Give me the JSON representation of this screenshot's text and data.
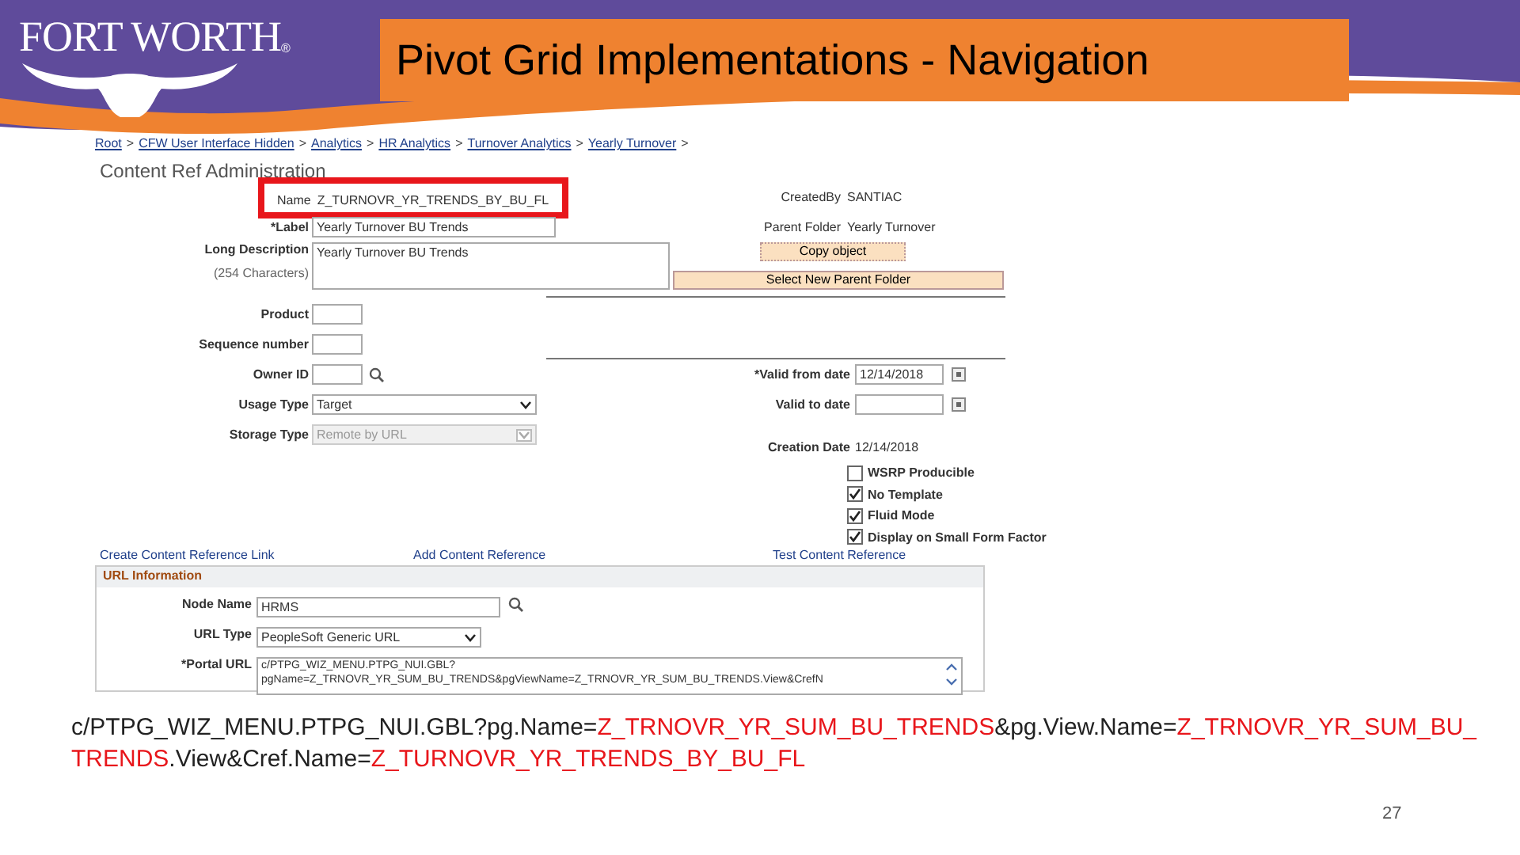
{
  "logo": {
    "text": "FORT WORTH",
    "mark": "®"
  },
  "title": "Pivot Grid Implementations - Navigation",
  "screenshot": {
    "breadcrumbs": [
      "Root",
      "CFW User Interface Hidden",
      "Analytics",
      "HR Analytics",
      "Turnover Analytics",
      "Yearly Turnover"
    ],
    "breadcrumb_separator": ">",
    "page_title": "Content Ref Administration",
    "name": {
      "label": "Name",
      "value": "Z_TURNOVR_YR_TRENDS_BY_BU_FL",
      "highlighted": true
    },
    "left_fields": [
      {
        "kind": "text",
        "label": "*Label",
        "value": "Yearly Turnover BU Trends"
      },
      {
        "kind": "textarea",
        "label": "Long Description",
        "sublabel": "(254 Characters)",
        "value": "Yearly Turnover BU Trends"
      },
      {
        "kind": "short",
        "label": "Product"
      },
      {
        "kind": "short",
        "label": "Sequence number"
      },
      {
        "kind": "lookup",
        "label": "Owner ID"
      },
      {
        "kind": "select",
        "label": "Usage Type",
        "value": "Target",
        "disabled": false
      },
      {
        "kind": "select",
        "label": "Storage Type",
        "value": "Remote by URL",
        "disabled": true
      }
    ],
    "created_by": {
      "label": "CreatedBy",
      "value": "SANTIAC"
    },
    "parent_folder": {
      "label": "Parent Folder",
      "value": "Yearly Turnover"
    },
    "copy_button": "Copy object",
    "select_parent_button": "Select New Parent Folder",
    "dates": [
      {
        "label": "*Valid from date",
        "value": "12/14/2018"
      },
      {
        "label": "Valid to date"
      }
    ],
    "creation_date": {
      "label": "Creation Date",
      "value": "12/14/2018"
    },
    "checkboxes": [
      {
        "label": "WSRP Producible",
        "checked": false
      },
      {
        "label": "No Template",
        "checked": true
      },
      {
        "label": "Fluid Mode",
        "checked": true
      },
      {
        "label": "Display on Small Form Factor",
        "checked": true
      }
    ],
    "links": [
      "Create Content Reference Link",
      "Add Content Reference",
      "Test Content Reference"
    ],
    "url_section": {
      "heading": "URL Information",
      "fields": [
        {
          "kind": "lookup",
          "label": "Node Name",
          "value": "HRMS"
        },
        {
          "kind": "select",
          "label": "URL Type",
          "value": "PeopleSoft Generic URL"
        },
        {
          "kind": "textarea",
          "label": "*Portal URL",
          "value": "c/PTPG_WIZ_MENU.PTPG_NUI.GBL?\npgName=Z_TRNOVR_YR_SUM_BU_TRENDS&pgViewName=Z_TRNOVR_YR_SUM_BU_TRENDS.View&CrefN"
        }
      ]
    }
  },
  "caption": [
    {
      "kind": "plain",
      "text": "c/PTPG_WIZ_MENU.PTPG_NUI.GBL?pg.Name="
    },
    {
      "kind": "highlight",
      "text": "Z_TRNOVR_YR_SUM_BU_TRENDS"
    },
    {
      "kind": "plain",
      "text": "&pg.View.Name="
    },
    {
      "kind": "highlight",
      "text": "Z_TRNOVR_YR_SUM_BU_TRENDS"
    },
    {
      "kind": "plain",
      "text": ".View&Cref.Name="
    },
    {
      "kind": "highlight",
      "text": "Z_TURNOVR_YR_TRENDS_BY_BU_FL"
    }
  ],
  "page_number": "27"
}
